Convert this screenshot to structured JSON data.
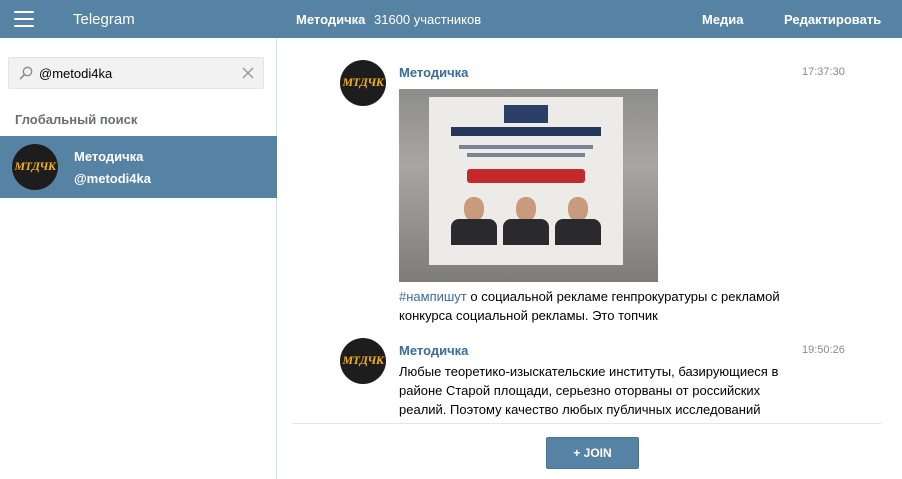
{
  "topbar": {
    "app_title": "Telegram",
    "chat_title": "Методичка",
    "chat_members": "31600 участников",
    "media_label": "Медиа",
    "edit_label": "Редактировать"
  },
  "sidebar": {
    "search": {
      "value": "@metodi4ka",
      "placeholder": ""
    },
    "global_search_label": "Глобальный поиск",
    "results": [
      {
        "name": "Методичка",
        "handle": "@metodi4ka",
        "avatar_text": "МТДЧК"
      }
    ]
  },
  "messages": [
    {
      "author": "Методичка",
      "time": "17:37:30",
      "avatar_text": "МТДЧК",
      "hashtag": "#нампишут",
      "text_line1": " о социальной рекламе генпрокуратуры с рекламой",
      "text_line2": "конкурса социальной рекламы. Это топчик"
    },
    {
      "author": "Методичка",
      "time": "19:50:26",
      "avatar_text": "МТДЧК",
      "text_lines": [
        "Любые теоретико-изыскательские институты, базирующиеся в",
        "районе Старой площади, серьезно оторваны от российских",
        "реалий. Поэтому качество любых публичных исследований"
      ]
    }
  ],
  "footer": {
    "join_label": "+ JOIN"
  },
  "colors": {
    "accent": "#5682a3",
    "link": "#3a6d99",
    "avatar_text": "#f0b018"
  }
}
